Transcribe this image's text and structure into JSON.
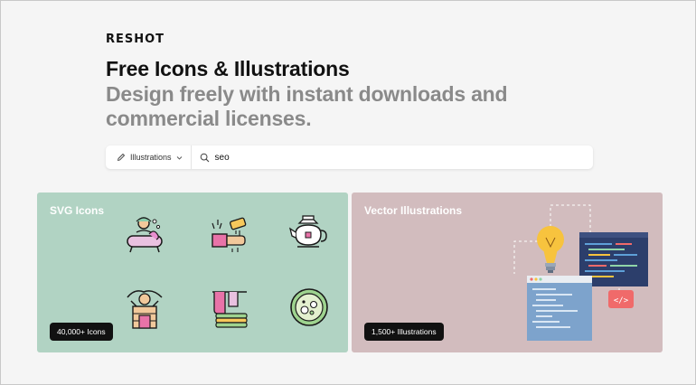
{
  "brand": {
    "logo_text": "RESHOT"
  },
  "hero": {
    "title": "Free Icons & Illustrations",
    "subtitle": "Design freely with instant downloads and commercial licenses."
  },
  "search": {
    "type_label": "Illustrations",
    "query": "seo"
  },
  "cards": {
    "icons": {
      "title": "SVG Icons",
      "badge": "40,000+ Icons"
    },
    "illustrations": {
      "title": "Vector Illustrations",
      "badge": "1,500+ Illustrations",
      "code_tag": "</>"
    }
  },
  "icon_names": [
    "bathtub-icon",
    "hand-washing-icon",
    "teapot-icon",
    "massage-icon",
    "towels-icon",
    "petri-dish-icon"
  ],
  "colors": {
    "icons_card_bg": "#b1d3c3",
    "illustrations_card_bg": "#d2bcbe",
    "badge_bg": "#111111",
    "code_tag_bg": "#f06a6a"
  }
}
